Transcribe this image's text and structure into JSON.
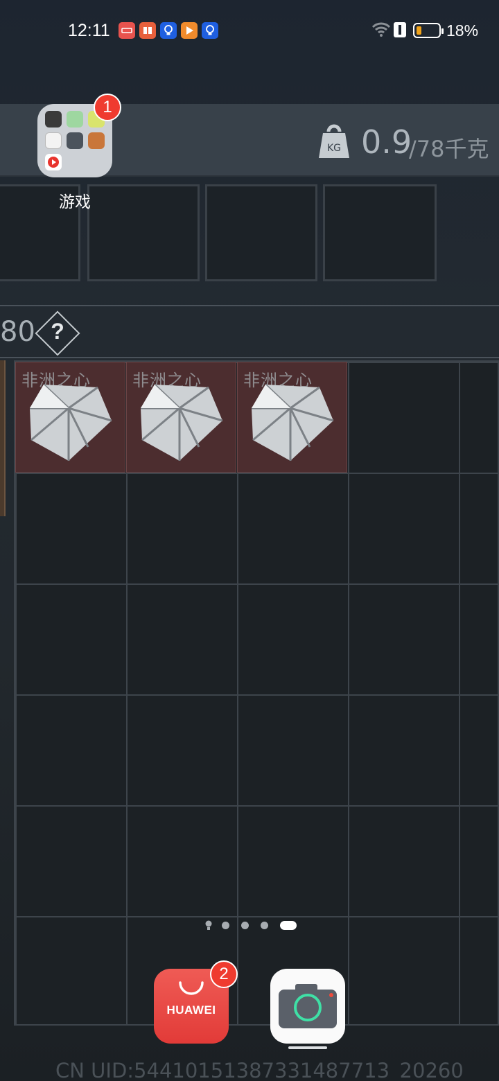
{
  "status_bar": {
    "time": "12:11",
    "battery_percent": "18%",
    "battery_level": 0.18,
    "notification_icons": [
      "huawei-appgallery-icon",
      "novel-reader-icon",
      "lightbulb-icon",
      "video-play-icon",
      "lightbulb-icon"
    ],
    "signal_icons": [
      "wifi-icon",
      "sim-alert-icon",
      "battery-icon"
    ]
  },
  "home_screen": {
    "folder": {
      "label": "游戏",
      "badge_count": "1",
      "apps": [
        "game-app-1",
        "game-app-2",
        "game-app-3",
        "game-app-4",
        "game-app-5",
        "game-app-6",
        "game-app-7"
      ]
    },
    "page_indicator": {
      "pages": 5,
      "current_page": 5
    },
    "dock": [
      {
        "name": "huawei-appgallery",
        "label": "HUAWEI",
        "badge_count": "2"
      },
      {
        "name": "camera",
        "label": ""
      }
    ]
  },
  "game_background": {
    "weight_current": "0.9",
    "weight_max": "/78千克",
    "weight_icon_text": "KG",
    "section_number": "80",
    "help_symbol": "?",
    "items": [
      {
        "label": "非洲之心"
      },
      {
        "label": "非洲之心"
      },
      {
        "label": "非洲之心"
      }
    ],
    "uid": "CN UID:5441015138733148​7713_20260"
  },
  "colors": {
    "badge": "#ef3b2f",
    "battery_fill": "#f0a31a",
    "item_cell": "#4c2d2f",
    "huawei_red": "#e23b38"
  }
}
